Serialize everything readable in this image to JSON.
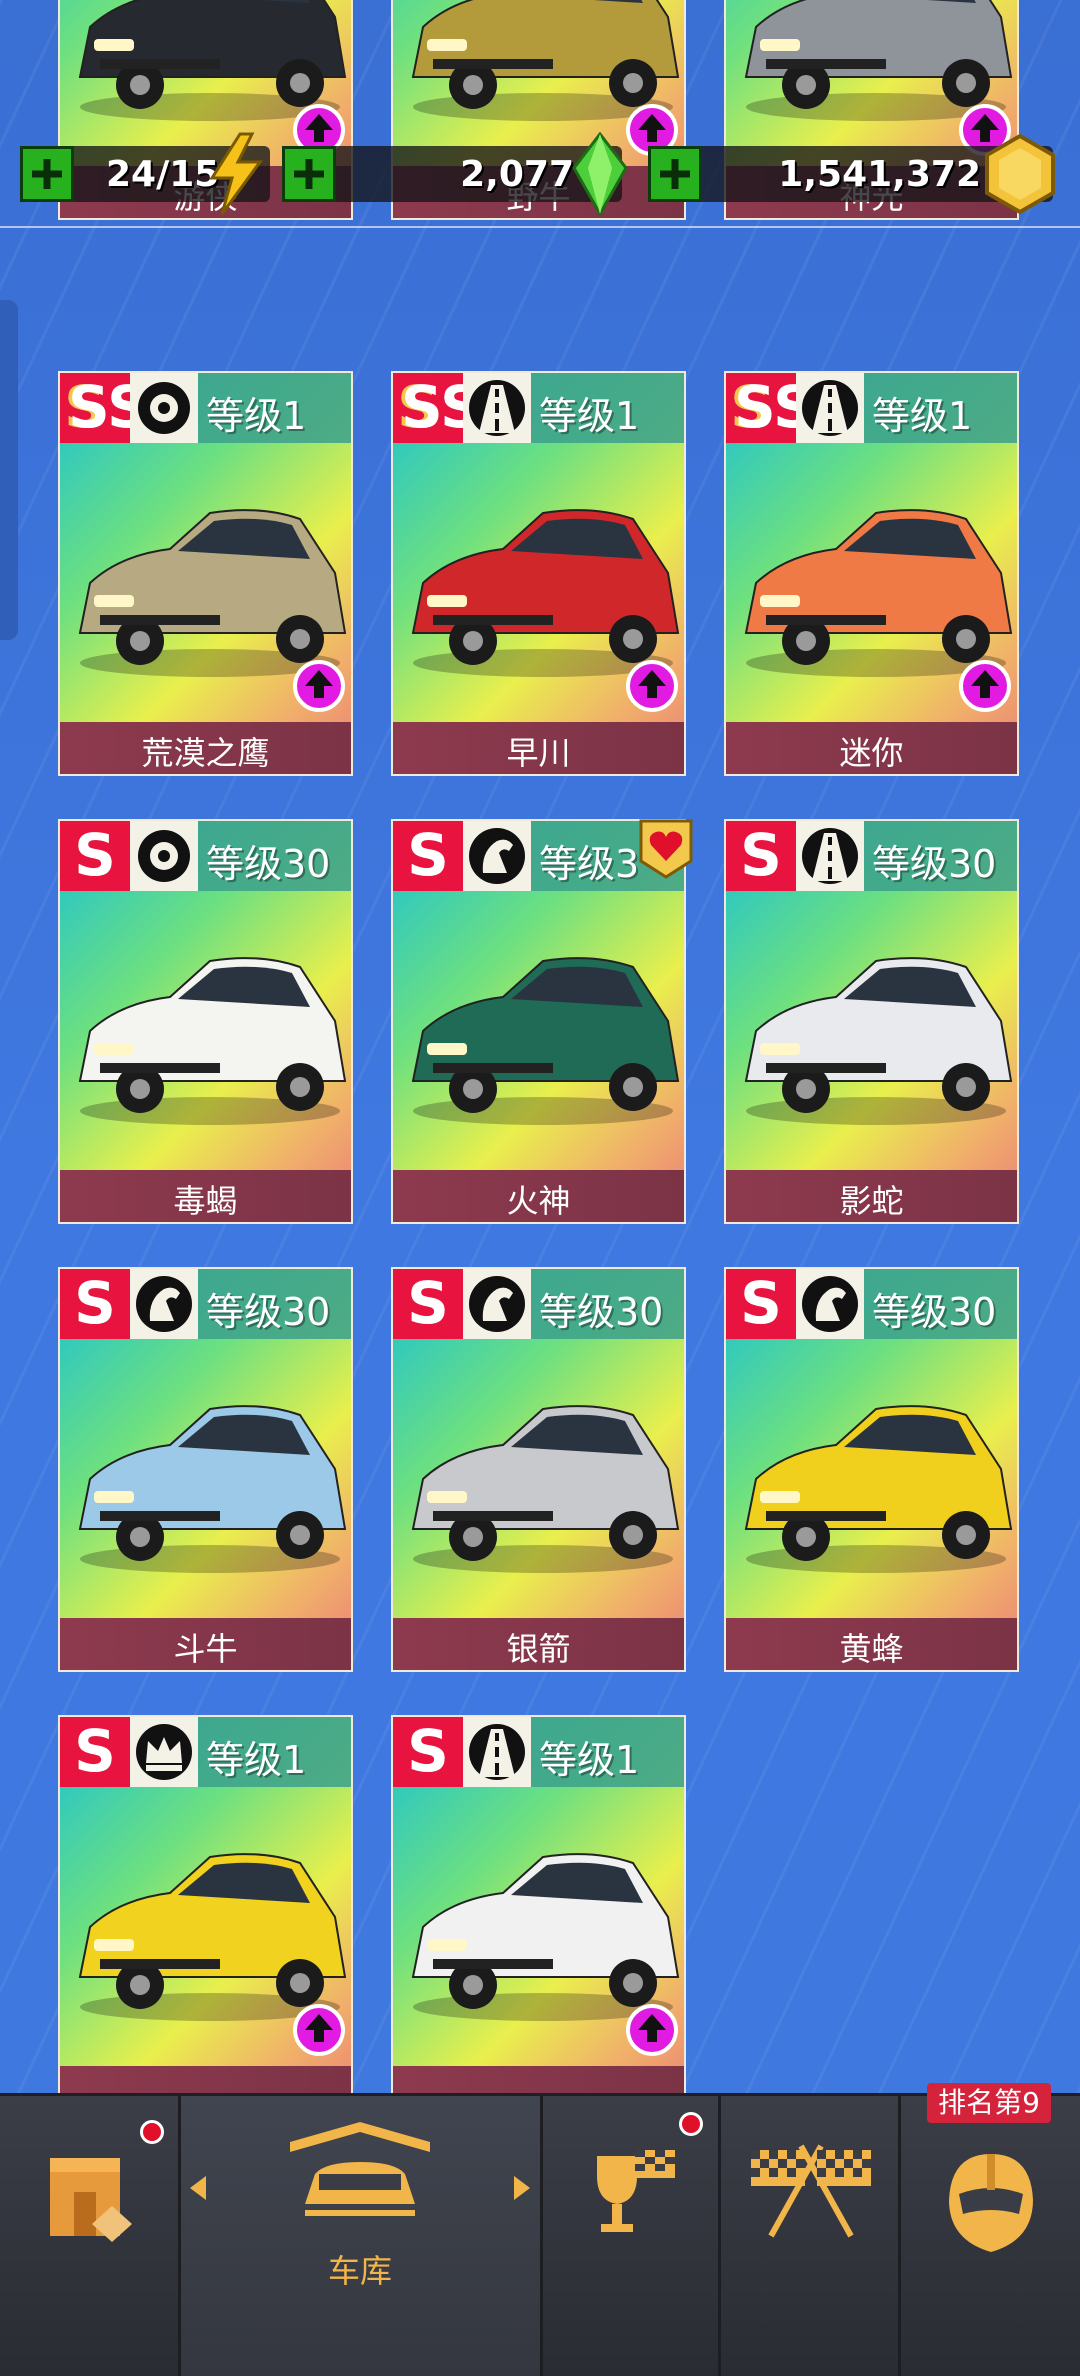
{
  "currency": {
    "energy": "24/15",
    "gems": "2,077",
    "coins": "1,541,372"
  },
  "cards": [
    {
      "name": "游侠",
      "tier": "",
      "level": "",
      "cls": "",
      "color": "#262a30"
    },
    {
      "name": "野牛",
      "tier": "",
      "level": "",
      "cls": "",
      "color": "#b39a3a"
    },
    {
      "name": "神光",
      "tier": "",
      "level": "",
      "cls": "",
      "color": "#8f949a"
    },
    {
      "name": "荒漠之鹰",
      "tier": "SS",
      "level": "等级1",
      "cls": "tire",
      "color": "#b7aa82"
    },
    {
      "name": "早川",
      "tier": "SS",
      "level": "等级1",
      "cls": "road",
      "color": "#d0282a"
    },
    {
      "name": "迷你",
      "tier": "SS",
      "level": "等级1",
      "cls": "road",
      "color": "#ef7a45"
    },
    {
      "name": "毒蝎",
      "tier": "S",
      "level": "等级30",
      "cls": "tire",
      "color": "#f4f4f0"
    },
    {
      "name": "火神",
      "tier": "S",
      "level": "等级3",
      "cls": "horse",
      "color": "#1f6b55"
    },
    {
      "name": "影蛇",
      "tier": "S",
      "level": "等级30",
      "cls": "road",
      "color": "#e9eaee"
    },
    {
      "name": "斗牛",
      "tier": "S",
      "level": "等级30",
      "cls": "horse",
      "color": "#9cc9e8"
    },
    {
      "name": "银箭",
      "tier": "S",
      "level": "等级30",
      "cls": "horse",
      "color": "#c7c9cc"
    },
    {
      "name": "黄蜂",
      "tier": "S",
      "level": "等级30",
      "cls": "horse",
      "color": "#f1cf1d"
    },
    {
      "name": "",
      "tier": "S",
      "level": "等级1",
      "cls": "crown",
      "color": "#f0d21f"
    },
    {
      "name": "",
      "tier": "S",
      "level": "等级1",
      "cls": "road",
      "color": "#f1f1f1"
    }
  ],
  "nav": {
    "garage_label": "车库",
    "rank_badge": "排名第9"
  },
  "icons": {
    "plus": "plus-icon",
    "energy": "lightning-icon",
    "gems": "gem-icon",
    "coins": "coin-icon",
    "upgrade": "upgrade-arrow-icon",
    "favorite": "heart-badge-icon"
  }
}
